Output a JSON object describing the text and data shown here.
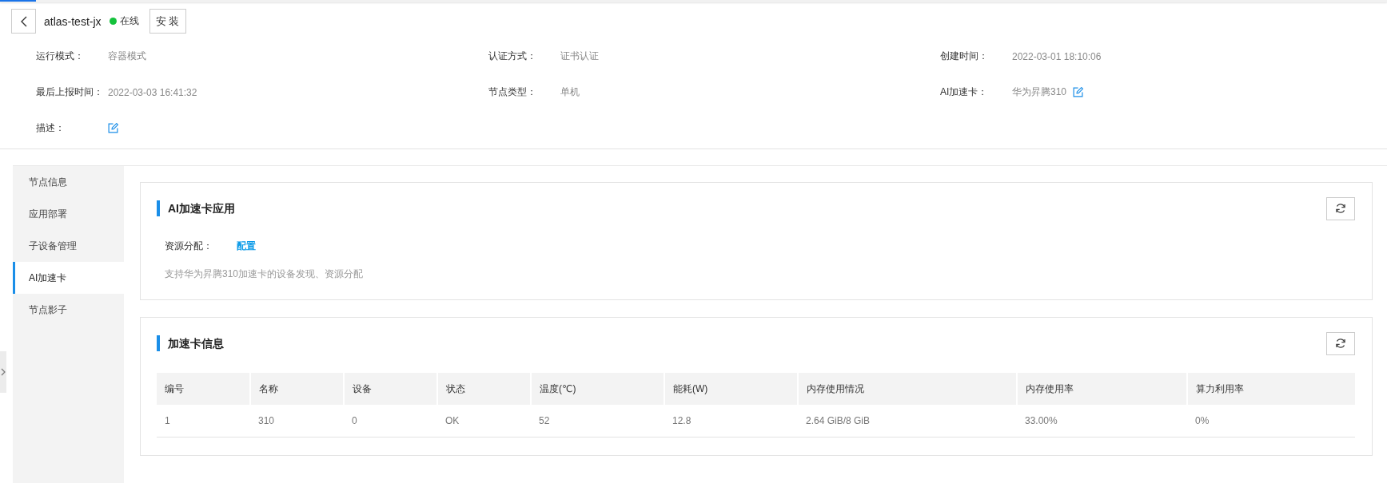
{
  "header": {
    "name": "atlas-test-jx",
    "status": {
      "label": "在线",
      "online": true
    },
    "install_button": "安 装"
  },
  "details": [
    {
      "label": "运行模式：",
      "value": "容器模式",
      "kind": "text"
    },
    {
      "label": "认证方式：",
      "value": "证书认证",
      "kind": "text"
    },
    {
      "label": "创建时间：",
      "value": "2022-03-01 18:10:06",
      "kind": "text"
    },
    {
      "label": "最后上报时间：",
      "value": "2022-03-03 16:41:32",
      "kind": "text"
    },
    {
      "label": "节点类型：",
      "value": "单机",
      "kind": "text"
    },
    {
      "label": "AI加速卡：",
      "value": "华为昇腾310",
      "kind": "editable"
    },
    {
      "label": "描述：",
      "kind": "editable"
    }
  ],
  "sidebar": {
    "items": [
      {
        "label": "节点信息",
        "selected": false
      },
      {
        "label": "应用部署",
        "selected": false
      },
      {
        "label": "子设备管理",
        "selected": false
      },
      {
        "label": "AI加速卡",
        "selected": true
      },
      {
        "label": "节点影子",
        "selected": false
      }
    ]
  },
  "panels": [
    {
      "kind": "config",
      "title": "AI加速卡应用",
      "field": {
        "label": "资源分配：",
        "link": "配置"
      },
      "note": "支持华为昇腾310加速卡的设备发现、资源分配"
    },
    {
      "kind": "table",
      "title": "加速卡信息",
      "table": {
        "columns": [
          "编号",
          "名称",
          "设备",
          "状态",
          "温度(℃)",
          "能耗(W)",
          "内存使用情况",
          "内存使用率",
          "算力利用率"
        ],
        "rows": [
          [
            "1",
            "310",
            "0",
            "OK",
            "52",
            "12.8",
            "2.64 GiB/8 GiB",
            "33.00%",
            "0%"
          ]
        ]
      }
    }
  ]
}
